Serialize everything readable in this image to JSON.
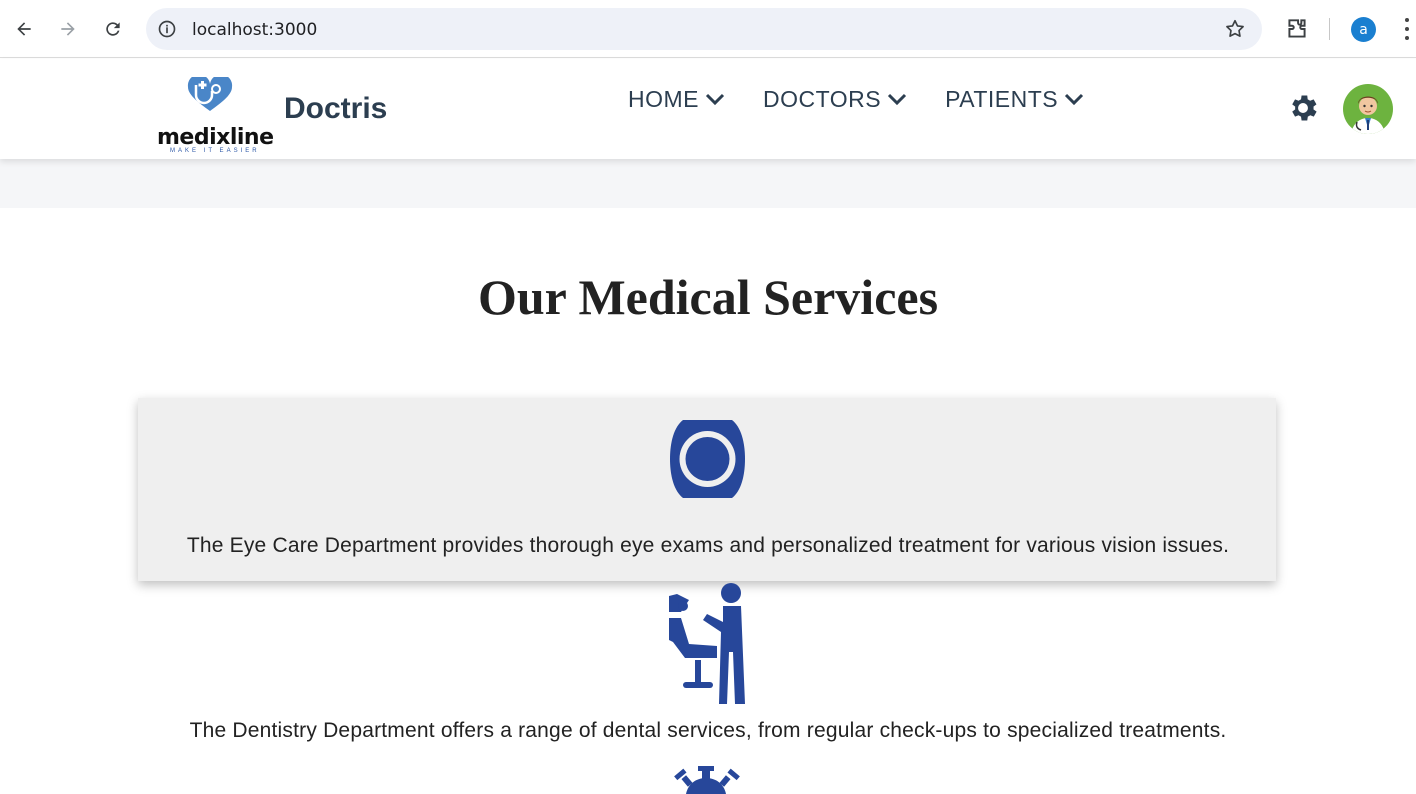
{
  "browser": {
    "url": "localhost:3000",
    "profile_initial": "a"
  },
  "header": {
    "logo_text": "medixline",
    "logo_tagline": "MAKE IT EASIER",
    "brand": "Doctris",
    "menu": [
      {
        "label": "HOME"
      },
      {
        "label": "DOCTORS"
      },
      {
        "label": "PATIENTS"
      }
    ]
  },
  "main": {
    "title": "Our Medical Services",
    "services": [
      {
        "icon": "eye-icon",
        "text": "The Eye Care Department provides thorough eye exams and personalized treatment for various vision issues."
      },
      {
        "icon": "dentist-chair-icon",
        "text": "The Dentistry Department offers a range of dental services, from regular check-ups to specialized treatments."
      },
      {
        "icon": "virus-icon",
        "text": ""
      }
    ]
  },
  "colors": {
    "icon_blue": "#27479a",
    "heading_text": "#2c3e50",
    "card_bg": "#efefef"
  }
}
